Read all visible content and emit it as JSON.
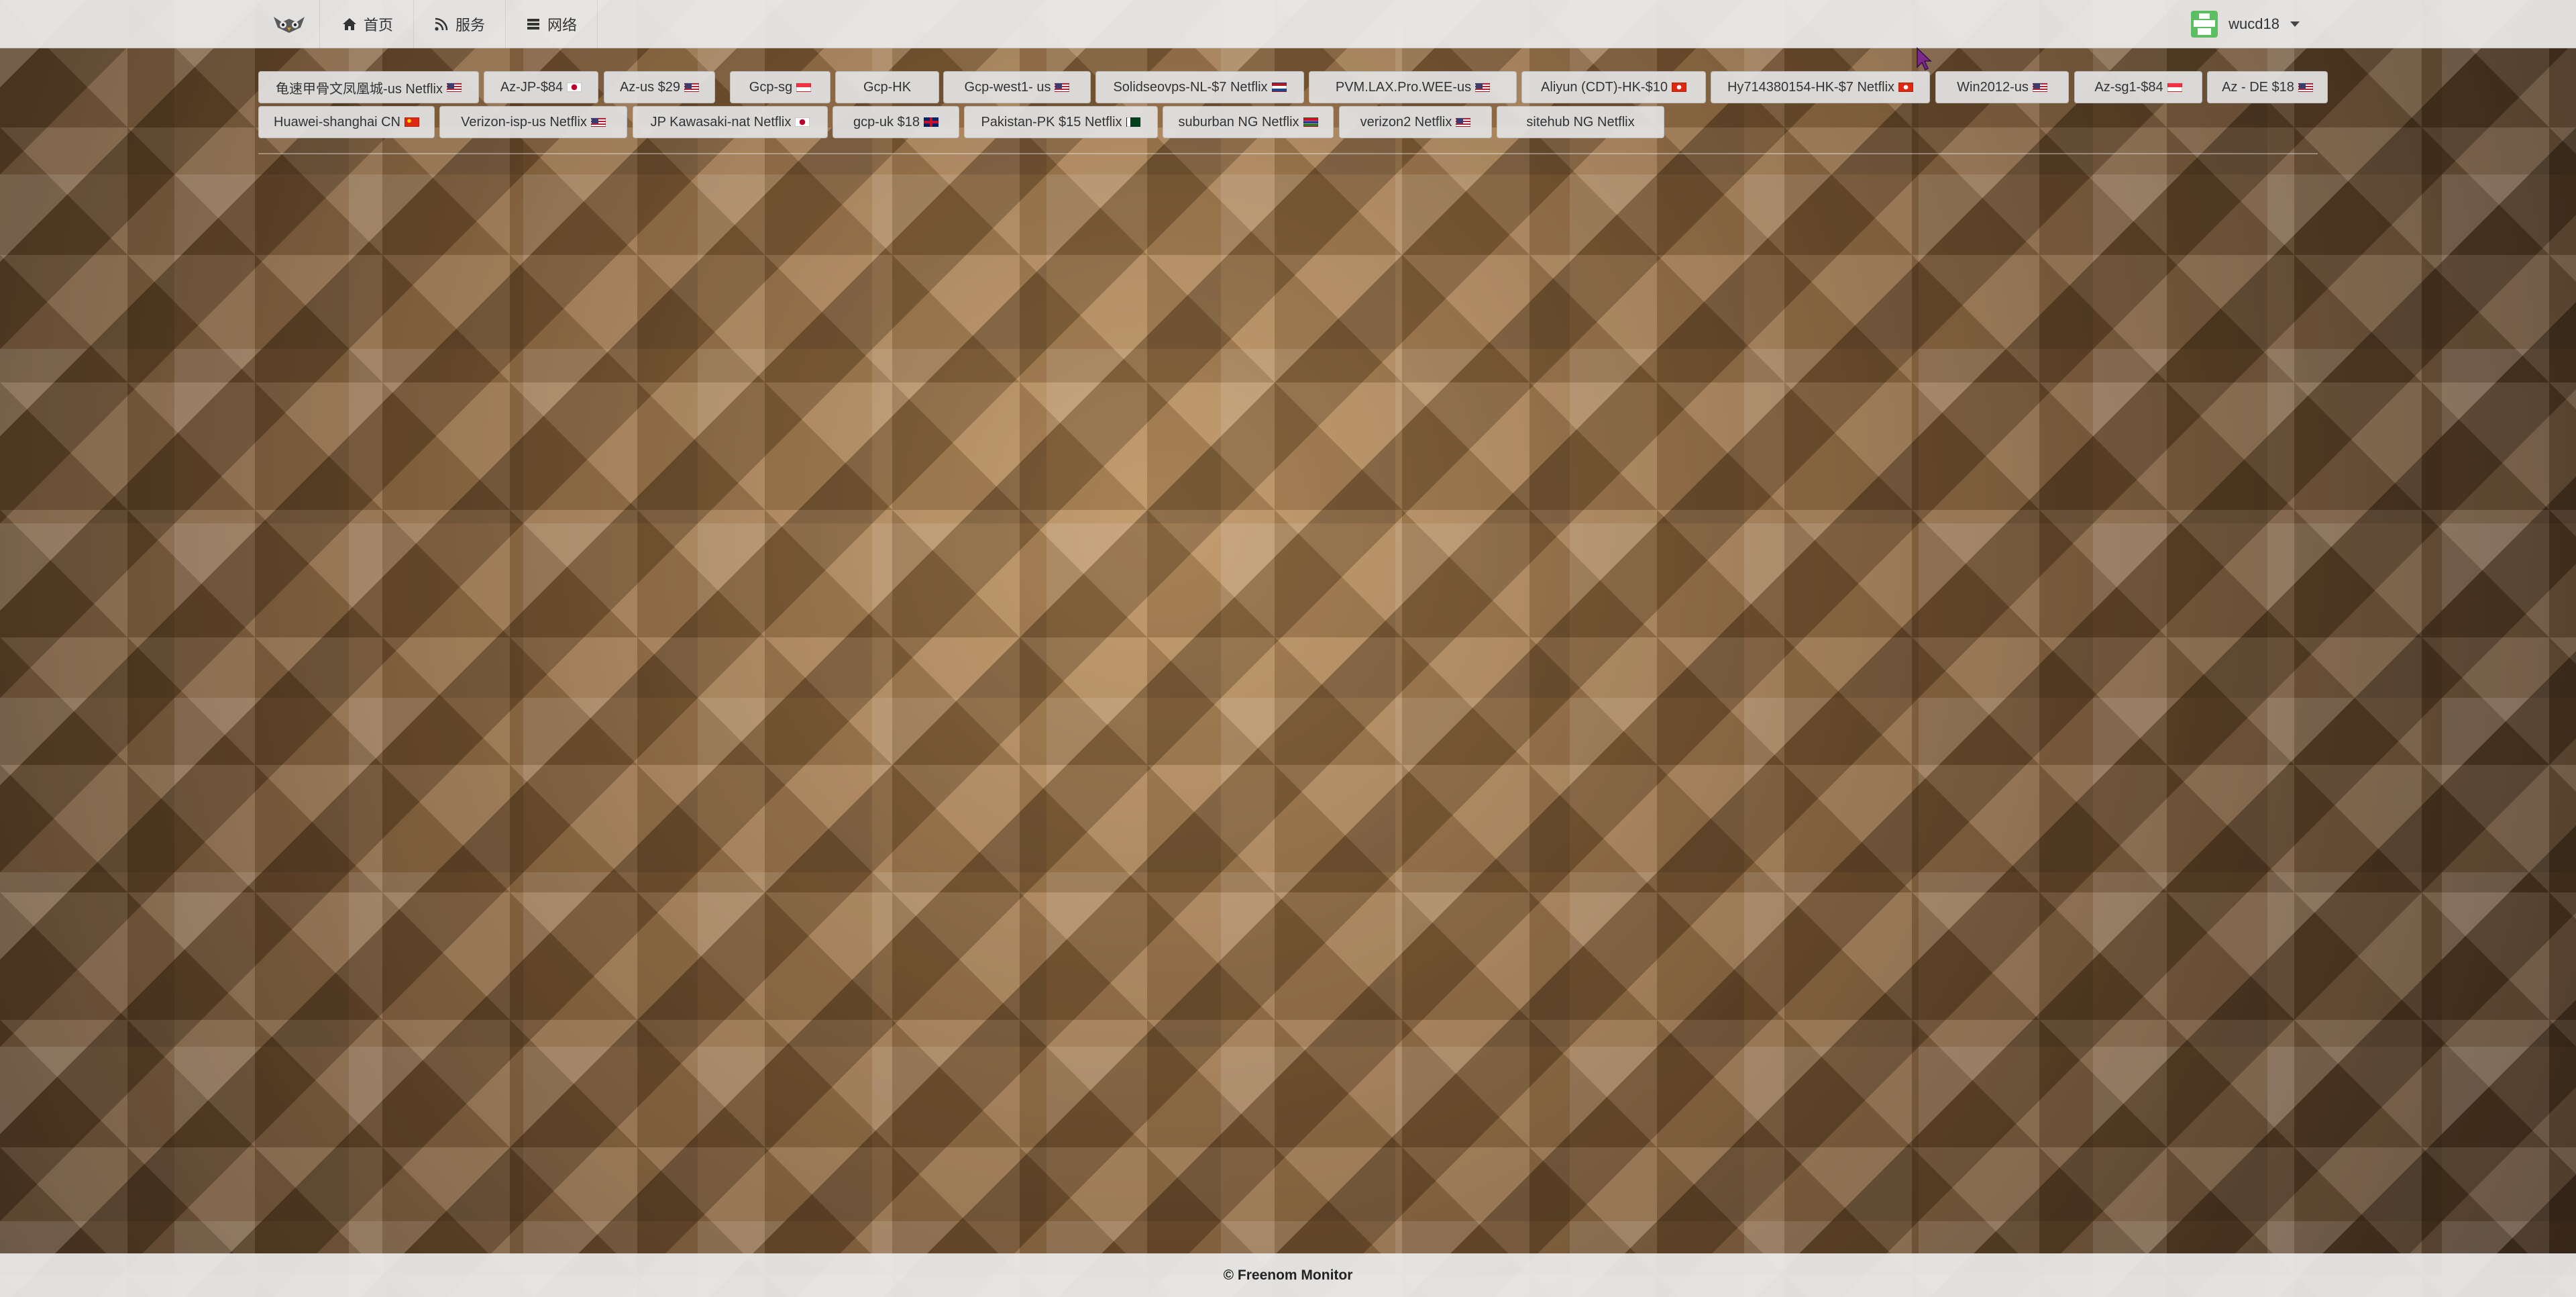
{
  "navbar": {
    "brand_icon": "owl-logo-icon",
    "items": [
      {
        "label": "首页",
        "icon": "home-icon"
      },
      {
        "label": "服务",
        "icon": "rss-icon"
      },
      {
        "label": "网络",
        "icon": "list-icon"
      }
    ],
    "user": {
      "name": "wucd18",
      "avatar_icon": "user-avatar-icon"
    }
  },
  "servers": [
    {
      "label": "龟速甲骨文凤凰城-us Netflix",
      "flag": "us"
    },
    {
      "label": "Az-JP-$84",
      "flag": "jp"
    },
    {
      "label": "Az-us $29",
      "flag": "us"
    },
    {
      "label": "Gcp-sg",
      "flag": "sg"
    },
    {
      "label": "Gcp-HK",
      "flag": ""
    },
    {
      "label": "Gcp-west1- us",
      "flag": "us"
    },
    {
      "label": "Solidseovps-NL-$7 Netflix",
      "flag": "nl"
    },
    {
      "label": "PVM.LAX.Pro.WEE-us",
      "flag": "us"
    },
    {
      "label": "Aliyun (CDT)-HK-$10",
      "flag": "hk"
    },
    {
      "label": "Hy714380154-HK-$7 Netflix",
      "flag": "hk"
    },
    {
      "label": "Win2012-us",
      "flag": "us"
    },
    {
      "label": "Az-sg1-$84",
      "flag": "sg"
    },
    {
      "label": "Az - DE $18",
      "flag": "us"
    },
    {
      "label": "Huawei-shanghai CN",
      "flag": "cn"
    },
    {
      "label": "Verizon-isp-us Netflix",
      "flag": "us"
    },
    {
      "label": "JP Kawasaki-nat Netflix",
      "flag": "jp"
    },
    {
      "label": "gcp-uk $18",
      "flag": "gb"
    },
    {
      "label": "Pakistan-PK $15 Netflix",
      "flag": "pk"
    },
    {
      "label": "suburban NG Netflix",
      "flag": "gm"
    },
    {
      "label": "verizon2 Netflix",
      "flag": "us"
    },
    {
      "label": "sitehub NG Netflix",
      "flag": ""
    }
  ],
  "footer": {
    "text": "© Freenom Monitor"
  }
}
